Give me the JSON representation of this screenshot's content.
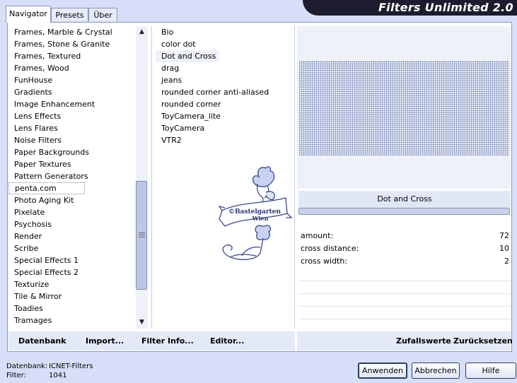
{
  "app": {
    "title": "Filters Unlimited 2.0"
  },
  "tabs": [
    {
      "label": "Navigator",
      "active": true
    },
    {
      "label": "Presets",
      "active": false
    },
    {
      "label": "Über",
      "active": false
    }
  ],
  "categories": [
    "Frames, Marble & Crystal",
    "Frames, Stone & Granite",
    "Frames, Textured",
    "Frames, Wood",
    "FunHouse",
    "Gradients",
    "Image Enhancement",
    "Lens Effects",
    "Lens Flares",
    "Noise Filters",
    "Paper Backgrounds",
    "Paper Textures",
    "Pattern Generators",
    "penta.com",
    "Photo Aging Kit",
    "Pixelate",
    "Psychosis",
    "Render",
    "Scribe",
    "Special Effects 1",
    "Special Effects 2",
    "Texturize",
    "Tile & Mirror",
    "Toadies",
    "Tramages"
  ],
  "selected_category": "penta.com",
  "filters": [
    "Bio",
    "color dot",
    "Dot and Cross",
    "drag",
    "jeans",
    "rounded corner anti-aliased",
    "rounded corner",
    "ToyCamera_lite",
    "ToyCamera",
    "VTR2"
  ],
  "selected_filter": "Dot and Cross",
  "preview": {
    "filter_name": "Dot and Cross"
  },
  "params": [
    {
      "label": "amount:",
      "value": "72"
    },
    {
      "label": "cross distance:",
      "value": "10"
    },
    {
      "label": "cross width:",
      "value": "2"
    }
  ],
  "toolbar": {
    "datenbank": "Datenbank",
    "import": "Import...",
    "filter_info": "Filter Info...",
    "editor": "Editor...",
    "zufallswerte": "Zufallswerte",
    "zuruecksetzen": "Zurücksetzen"
  },
  "status": {
    "db_label": "Datenbank:",
    "db_value": "ICNET-Filters",
    "filter_label": "Filter:",
    "filter_value": "1041"
  },
  "buttons": {
    "apply": "Anwenden",
    "cancel": "Abbrechen",
    "help": "Hilfe"
  },
  "watermark": {
    "line1": "©Bastelgarten",
    "line2": "Wien"
  },
  "colors": {
    "background": "#d6dff7",
    "banner": "#1c1c2e",
    "accent": "#8d96b5"
  }
}
